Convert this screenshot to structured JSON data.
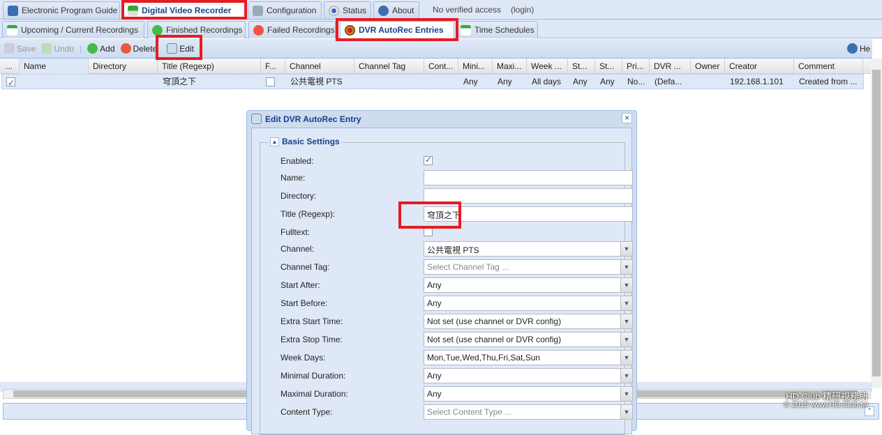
{
  "top_tabs": [
    {
      "label": "Electronic Program Guide",
      "icon": "epg-icon"
    },
    {
      "label": "Digital Video Recorder",
      "icon": "dvr-download-icon"
    },
    {
      "label": "Configuration",
      "icon": "wrench-icon"
    },
    {
      "label": "Status",
      "icon": "eye-icon"
    },
    {
      "label": "About",
      "icon": "info-icon"
    }
  ],
  "access": {
    "status": "No verified access",
    "login": "(login)"
  },
  "sub_tabs": [
    {
      "label": "Upcoming / Current Recordings",
      "icon": "calendar-icon"
    },
    {
      "label": "Finished Recordings",
      "icon": "check-icon"
    },
    {
      "label": "Failed Recordings",
      "icon": "error-icon"
    },
    {
      "label": "DVR AutoRec Entries",
      "icon": "autorec-icon"
    },
    {
      "label": "Time Schedules",
      "icon": "schedule-icon"
    }
  ],
  "toolbar": {
    "save": "Save",
    "undo": "Undo",
    "add": "Add",
    "delete": "Delete",
    "edit": "Edit",
    "help": "He"
  },
  "grid": {
    "columns": [
      "...",
      "Name",
      "Directory",
      "Title (Regexp)",
      "F...",
      "Channel",
      "Channel Tag",
      "Cont...",
      "Mini...",
      "Maxi...",
      "Week ...",
      "St...",
      "St...",
      "Pri...",
      "DVR ...",
      "Owner",
      "Creator",
      "Comment"
    ],
    "rows": [
      {
        "enabled": true,
        "name": "",
        "directory": "",
        "title": "穹頂之下",
        "fulltext": false,
        "channel": "公共電視 PTS",
        "channel_tag": "",
        "content": "",
        "min": "Any",
        "max": "Any",
        "week": "All days",
        "start": "Any",
        "start_before": "Any",
        "pri": "No...",
        "dvr": "(Defa...",
        "owner": "",
        "creator": "192.168.1.101",
        "comment": "Created from ..."
      }
    ]
  },
  "dialog": {
    "title": "Edit DVR AutoRec Entry",
    "section": "Basic Settings",
    "fields": {
      "enabled": {
        "label": "Enabled:",
        "checked": true
      },
      "name": {
        "label": "Name:",
        "value": ""
      },
      "directory": {
        "label": "Directory:",
        "value": ""
      },
      "title": {
        "label": "Title (Regexp):",
        "value": "穹頂之下"
      },
      "fulltext": {
        "label": "Fulltext:",
        "checked": false
      },
      "channel": {
        "label": "Channel:",
        "value": "公共電視 PTS"
      },
      "channel_tag": {
        "label": "Channel Tag:",
        "placeholder": "Select Channel Tag ..."
      },
      "start_after": {
        "label": "Start After:",
        "value": "Any"
      },
      "start_before": {
        "label": "Start Before:",
        "value": "Any"
      },
      "extra_start": {
        "label": "Extra Start Time:",
        "value": "Not set (use channel or DVR config)"
      },
      "extra_stop": {
        "label": "Extra Stop Time:",
        "value": "Not set (use channel or DVR config)"
      },
      "week_days": {
        "label": "Week Days:",
        "value": "Mon,Tue,Wed,Thu,Fri,Sat,Sun"
      },
      "min_duration": {
        "label": "Minimal Duration:",
        "value": "Any"
      },
      "max_duration": {
        "label": "Maximal Duration:",
        "value": "Any"
      },
      "content_type": {
        "label": "Content Type:",
        "placeholder": "Select Content Type ..."
      }
    }
  },
  "watermark": {
    "line1": "HD.Club 精研視務所",
    "line2": "© 2015  www.HD.Club.tw"
  },
  "colors": {
    "highlight": "#e51c23",
    "accent": "#15428b"
  }
}
